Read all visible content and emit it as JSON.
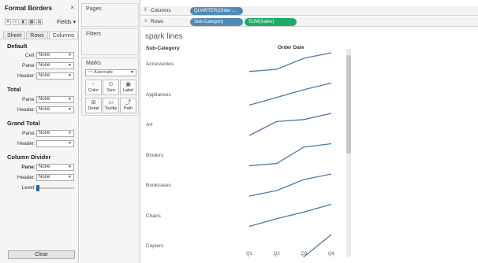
{
  "format_panel": {
    "title": "Format Borders",
    "close_glyph": "×",
    "fields_label": "Fields ▾",
    "tabs": [
      "Sheet",
      "Rows",
      "Columns"
    ],
    "active_tab": "Columns",
    "sections": {
      "default": {
        "title": "Default",
        "cell": {
          "label": "Cell:",
          "value": "None"
        },
        "pane": {
          "label": "Pane:",
          "value": "None"
        },
        "header": {
          "label": "Header:",
          "value": "None"
        }
      },
      "total": {
        "title": "Total",
        "pane": {
          "label": "Pane:",
          "value": "None"
        },
        "header": {
          "label": "Header:",
          "value": "None"
        }
      },
      "grand_total": {
        "title": "Grand Total",
        "pane": {
          "label": "Pane:",
          "value": "None"
        },
        "header": {
          "label": "Header:",
          "value": ""
        }
      },
      "column_divider": {
        "title": "Column Divider",
        "pane": {
          "label": "Pane:",
          "value": "None"
        },
        "header": {
          "label": "Header:",
          "value": "None"
        },
        "level": {
          "label": "Level:",
          "value": 0
        }
      }
    },
    "clear_label": "Clear"
  },
  "cards": {
    "pages": "Pages",
    "filters": "Filters",
    "marks": {
      "title": "Marks",
      "type": "Automatic",
      "buttons": [
        "Color",
        "Size",
        "Label",
        "Detail",
        "Tooltip",
        "Path"
      ]
    }
  },
  "shelves": {
    "columns": {
      "label": "Columns",
      "pills": [
        "QUARTER(Order ..."
      ]
    },
    "rows": {
      "label": "Rows",
      "pills": [
        "Sub-Category",
        "SUM(Sales)"
      ]
    }
  },
  "viz": {
    "title": "spark lines",
    "row_header": "Sub-Category",
    "column_header": "Order Date"
  },
  "colors": {
    "line": "#4e79a7",
    "pill_dimension": "#4e8ab4",
    "pill_measure": "#1eaa6a",
    "accent": "#1f6aa5"
  },
  "chart_data": {
    "type": "line",
    "title": "spark lines",
    "xlabel": "Order Date",
    "ylabel": "Sub-Category",
    "x": [
      "Q1",
      "Q2",
      "Q3",
      "Q4"
    ],
    "series": [
      {
        "name": "Accessories",
        "values": [
          0.15,
          0.25,
          0.75,
          1.0
        ]
      },
      {
        "name": "Appliances",
        "values": [
          0.0,
          0.35,
          0.7,
          1.0
        ]
      },
      {
        "name": "Art",
        "values": [
          0.0,
          0.63,
          0.72,
          1.0
        ]
      },
      {
        "name": "Binders",
        "values": [
          0.0,
          0.1,
          0.85,
          1.0
        ]
      },
      {
        "name": "Bookcases",
        "values": [
          0.0,
          0.25,
          0.75,
          1.0
        ]
      },
      {
        "name": "Chairs",
        "values": [
          0.0,
          0.35,
          0.65,
          1.0
        ]
      },
      {
        "name": "Copiers",
        "values": [
          null,
          null,
          0.0,
          1.0
        ]
      }
    ],
    "grid": false,
    "legend": "none"
  }
}
